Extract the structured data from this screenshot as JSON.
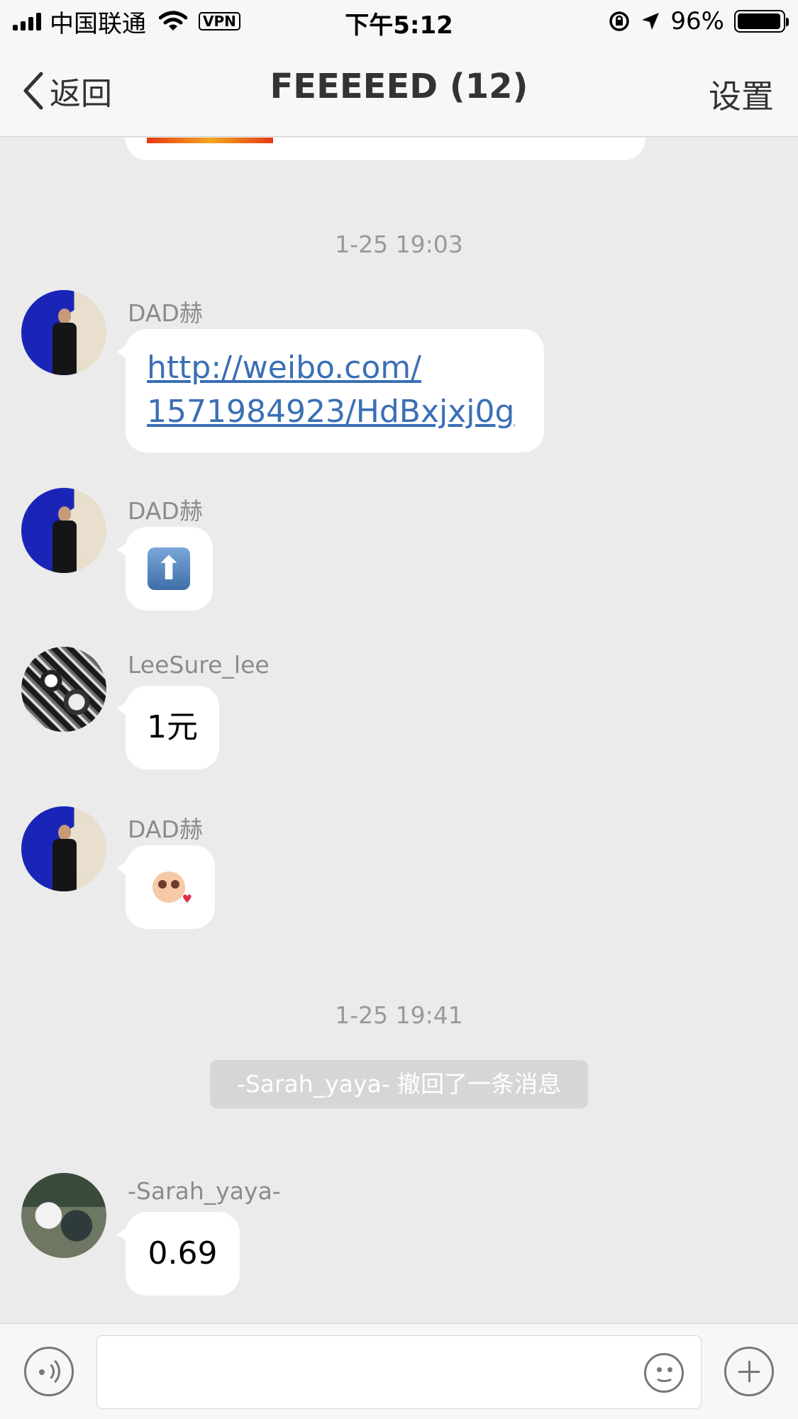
{
  "status_bar": {
    "carrier": "中国联通",
    "vpn": "VPN",
    "time": "下午5:12",
    "battery": "96%"
  },
  "nav": {
    "back": "返回",
    "title": "FEEEEED (12)",
    "settings": "设置"
  },
  "chat": {
    "timestamp_1": "1-25 19:03",
    "timestamp_2": "1-25 19:41",
    "recall_notice": "-Sarah_yaya- 撤回了一条消息",
    "messages": [
      {
        "sender": "DAD赫",
        "type": "link",
        "line1": "http://weibo.com/",
        "line2": "1571984923/HdBxjxj0g"
      },
      {
        "sender": "DAD赫",
        "type": "emoji",
        "emoji": "up-arrow-icon"
      },
      {
        "sender": "LeeSure_lee",
        "type": "text",
        "text": "1元"
      },
      {
        "sender": "DAD赫",
        "type": "sticker",
        "emoji": "sticker"
      },
      {
        "sender": "-Sarah_yaya-",
        "type": "text",
        "text": "0.69"
      }
    ]
  },
  "input_bar": {
    "text_value": "",
    "icons": [
      "voice-icon",
      "emoji-icon",
      "plus-icon"
    ]
  }
}
